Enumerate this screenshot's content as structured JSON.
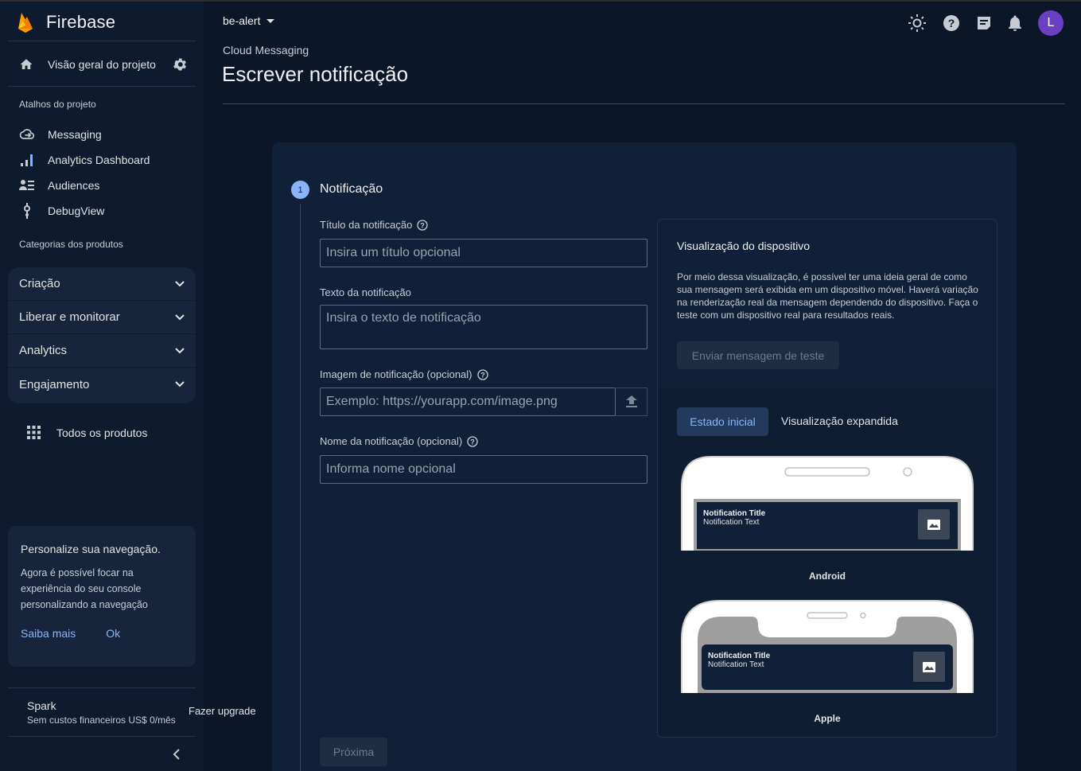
{
  "app": {
    "name": "Firebase"
  },
  "sidebar": {
    "overview_label": "Visão geral do projeto",
    "shortcuts_title": "Atalhos do projeto",
    "shortcuts": [
      {
        "label": "Messaging",
        "icon": "cloud-messaging-icon"
      },
      {
        "label": "Analytics Dashboard",
        "icon": "bar-chart-icon"
      },
      {
        "label": "Audiences",
        "icon": "audiences-icon"
      },
      {
        "label": "DebugView",
        "icon": "debug-icon"
      }
    ],
    "categories_title": "Categorias dos produtos",
    "categories": [
      {
        "label": "Criação"
      },
      {
        "label": "Liberar e monitorar"
      },
      {
        "label": "Analytics"
      },
      {
        "label": "Engajamento"
      }
    ],
    "all_products": "Todos os produtos",
    "promo": {
      "title": "Personalize sua navegação.",
      "text": "Agora é possível focar na experiência do seu console personalizando a navegação",
      "learn_more": "Saiba mais",
      "ok": "Ok"
    },
    "plan": {
      "name": "Spark",
      "desc": "Sem custos financeiros US$ 0/mês",
      "upgrade": "Fazer upgrade"
    }
  },
  "header": {
    "project": "be-alert",
    "avatar_letter": "L",
    "avatar_color": "#6a3fc4",
    "breadcrumb": "Cloud Messaging",
    "title": "Escrever notificação"
  },
  "form": {
    "step_number": "1",
    "step_title": "Notificação",
    "title_label": "Título da notificação",
    "title_placeholder": "Insira um título opcional",
    "text_label": "Texto da notificação",
    "text_placeholder": "Insira o texto de notificação",
    "image_label": "Imagem de notificação (opcional)",
    "image_placeholder": "Exemplo: https://yourapp.com/image.png",
    "name_label": "Nome da notificação (opcional)",
    "name_placeholder": "Informa nome opcional",
    "next_button": "Próxima"
  },
  "preview": {
    "title": "Visualização do dispositivo",
    "description": "Por meio dessa visualização, é possível ter uma ideia geral de como sua mensagem será exibida em um dispositivo móvel. Haverá variação na renderização real da mensagem dependendo do dispositivo. Faça o teste com um dispositivo real para resultados reais.",
    "test_button": "Enviar mensagem de teste",
    "tabs": {
      "initial": "Estado inicial",
      "expanded": "Visualização expandida"
    },
    "notification_title": "Notification Title",
    "notification_text": "Notification Text",
    "android_label": "Android",
    "apple_label": "Apple"
  },
  "colors": {
    "accent": "#8ab4f8",
    "background": "#0b1629",
    "sidebar": "#0e1b2f",
    "card": "#102038"
  }
}
